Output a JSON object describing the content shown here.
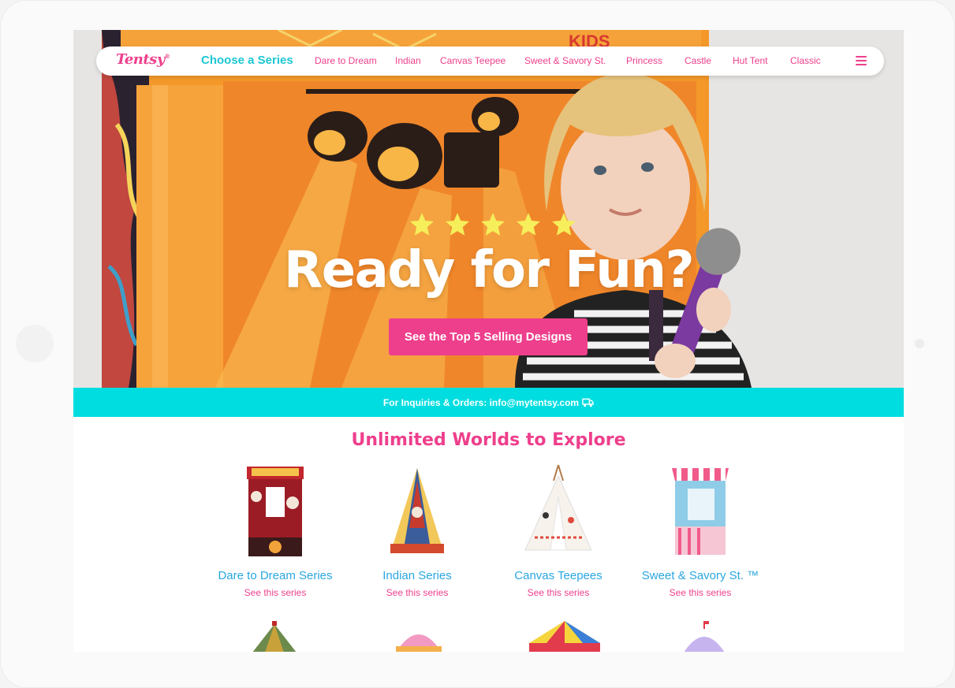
{
  "brand": {
    "logo": "Tentsy",
    "logo_mark": "®"
  },
  "nav": {
    "choose_label": "Choose a Series",
    "links": [
      "Dare to Dream",
      "Indian",
      "Canvas Teepee",
      "Sweet & Savory St.",
      "Princess",
      "Castle",
      "Hut Tent",
      "Classic"
    ],
    "menu_icon": "hamburger-icon"
  },
  "hero": {
    "sign_text": "KIDS",
    "rating_stars": 5,
    "headline": "Ready for Fun?",
    "cta_label": "See the Top 5 Selling Designs"
  },
  "inquiry": {
    "text": "For Inquiries & Orders: info@mytentsy.com",
    "icon": "truck-icon"
  },
  "section": {
    "title": "Unlimited Worlds to Explore",
    "cards": [
      {
        "name": "Dare to Dream Series",
        "link": "See this series"
      },
      {
        "name": "Indian Series",
        "link": "See this series"
      },
      {
        "name": "Canvas Teepees",
        "link": "See this series"
      },
      {
        "name": "Sweet & Savory St. ™",
        "link": "See this series"
      }
    ]
  },
  "colors": {
    "accent_pink": "#ee3f8c",
    "accent_cyan": "#00dde0",
    "series_blue": "#2aa7e0",
    "star_yellow": "#f6ee5a",
    "tent_orange": "#f49a2c"
  }
}
